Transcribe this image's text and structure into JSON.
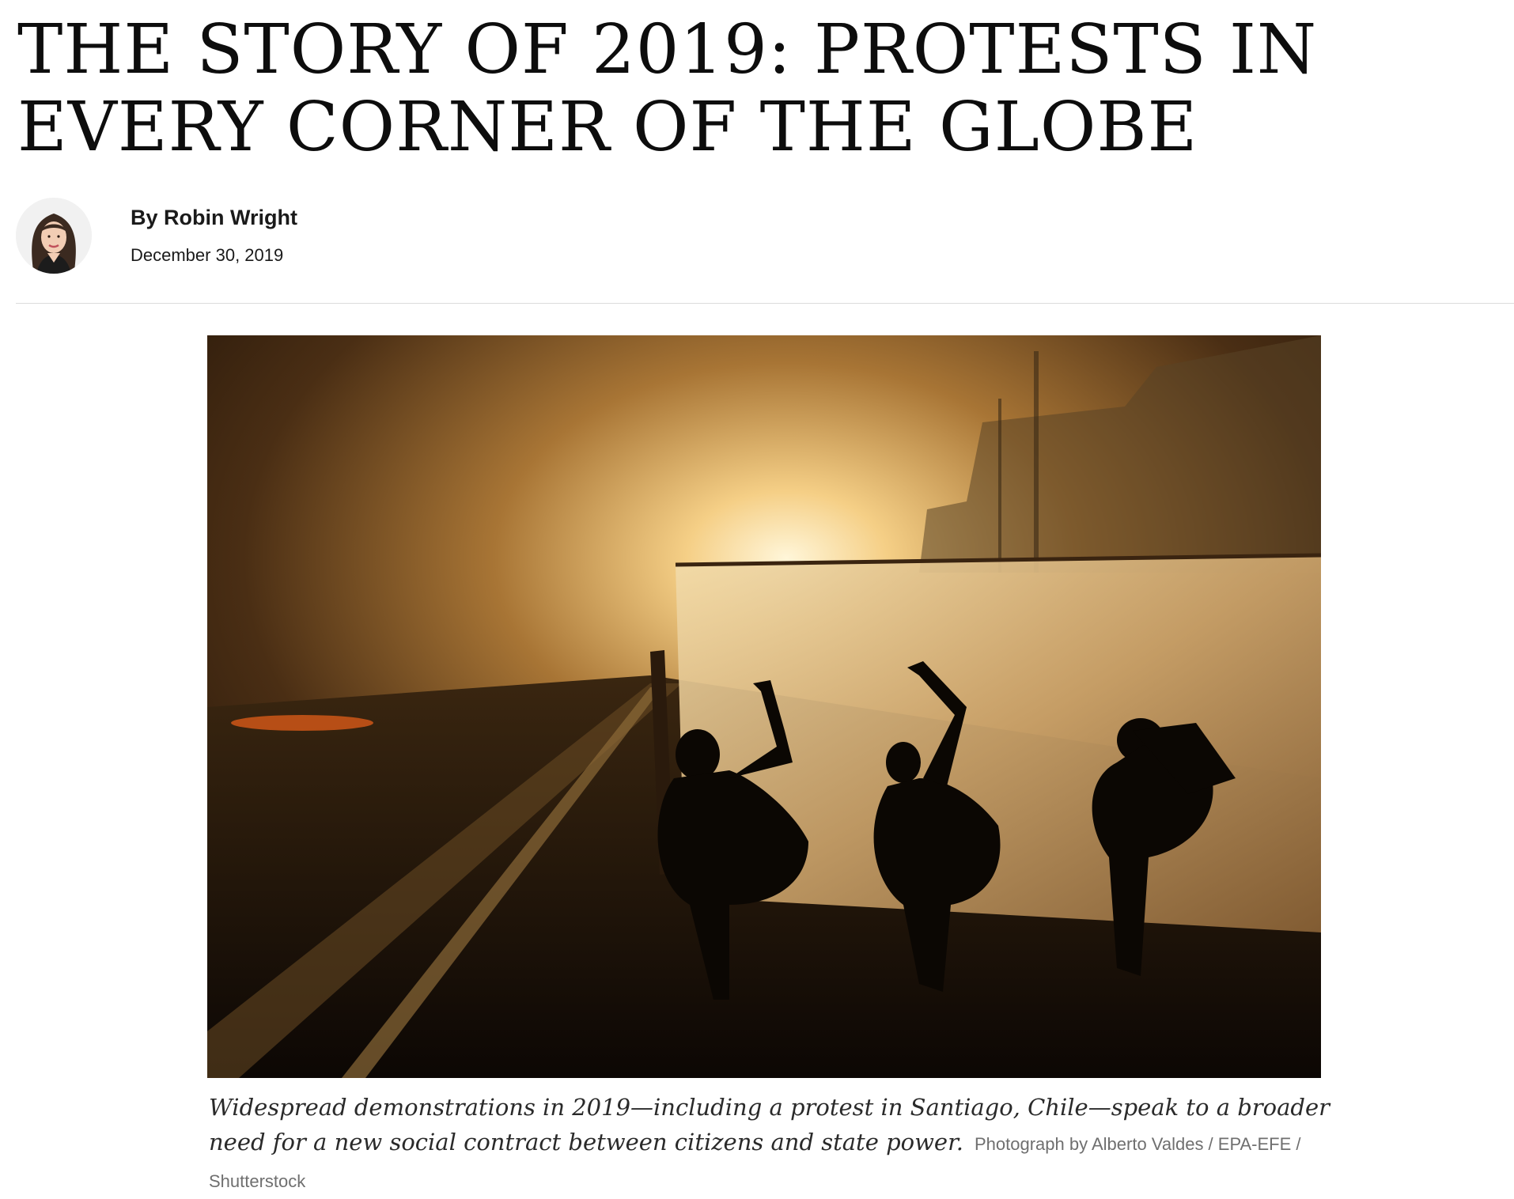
{
  "article": {
    "headline": "THE STORY OF 2019: PROTESTS IN EVERY CORNER OF THE GLOBE",
    "author": "By Robin Wright",
    "date": "December 30, 2019"
  },
  "hero_image": {
    "caption": "Widespread demonstrations in 2019—including a protest in Santiago, Chile—speak to a broader need for a new social contract between citizens and state power.",
    "credit": "Photograph by Alberto Valdes / EPA-EFE / Shutterstock"
  },
  "colors": {
    "headline": "#0d0d0d",
    "text": "#1a1a1a",
    "caption": "#2a2a2a",
    "credit": "#6f6f6f",
    "divider": "#dcdcdc"
  }
}
